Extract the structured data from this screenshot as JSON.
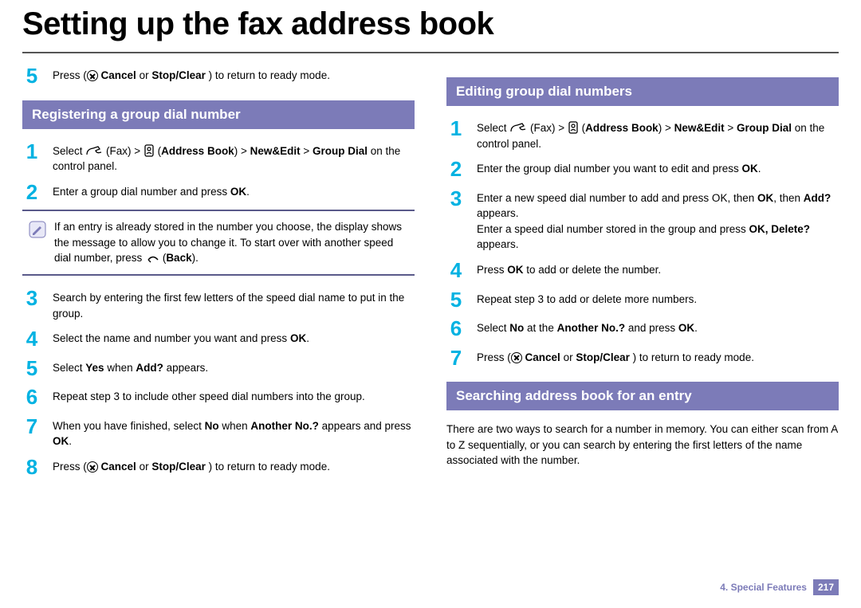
{
  "title": "Setting up the fax address book",
  "left": {
    "step5": {
      "pre": "Press ",
      "cancel": "Cancel",
      "or": " or ",
      "stop": "Stop/Clear",
      "post": ") to return to ready mode."
    },
    "sectionA": {
      "heading": "Registering a group dial number",
      "step1": {
        "pre": "Select ",
        "ab": "Address Book",
        "sep1": " > ",
        "ne": "New&Edit",
        "sep2": " > ",
        "gd": "Group Dial",
        "post": " on the control panel."
      },
      "step2": "Enter a group dial number and press OK.",
      "note": "If an entry is already stored in the number you choose, the display shows the message to allow you to change it. To start over with another speed dial number, press ",
      "note_back": "Back",
      "step3": "Search by entering the first few letters of the speed dial name to put in the group.",
      "step4": "Select the name and number you want and press OK.",
      "step5_a": "Select ",
      "step5_yes": "Yes",
      "step5_b": " when ",
      "step5_add": "Add?",
      "step5_c": " appears.",
      "step6": "Repeat step 3 to include other speed dial numbers into the group.",
      "step7_a": "When you have finished, select ",
      "step7_no": "No",
      "step7_b": " when ",
      "step7_ano": "Another No.?",
      "step7_c": " appears and press ",
      "step7_ok": "OK",
      "step8": {
        "pre": "Press ",
        "cancel": "Cancel",
        "or": " or ",
        "stop": "Stop/Clear",
        "post": ") to return to ready mode."
      }
    }
  },
  "right": {
    "sectionB": {
      "heading": "Editing group dial numbers",
      "step1": {
        "pre": "Select ",
        "ab": "Address Book",
        "sep1": " > ",
        "ne": "New&Edit",
        "sep2": " > ",
        "gd": "Group Dial",
        "post": " on the control panel."
      },
      "step2": "Enter the group dial number you want to edit and press OK.",
      "step3_a": "Enter a new speed dial number to add and press OK, then ",
      "step3_add": "Add?",
      "step3_b": " appears.",
      "step3_c": "Enter a speed dial number stored in the group and press ",
      "step3_del": "OK, Delete?",
      "step3_d": " appears.",
      "step4_a": "Press ",
      "step4_ok": "OK",
      "step4_b": " to add or delete the number.",
      "step5": "Repeat step 3 to add or delete more numbers.",
      "step6_a": "Select ",
      "step6_no": "No",
      "step6_b": " at the ",
      "step6_ano": "Another No.?",
      "step6_c": " and press ",
      "step6_ok": "OK",
      "step7": {
        "pre": "Press ",
        "cancel": "Cancel",
        "or": " or ",
        "stop": "Stop/Clear",
        "post": ") to return to ready mode."
      }
    },
    "sectionC": {
      "heading": "Searching address book for an entry",
      "para": "There are two ways to search for a number in memory. You can either scan from A to Z sequentially, or you can search by entering the first letters of the name associated with the number."
    }
  },
  "footer": {
    "chapter": "4.  Special Features",
    "page": "217"
  }
}
